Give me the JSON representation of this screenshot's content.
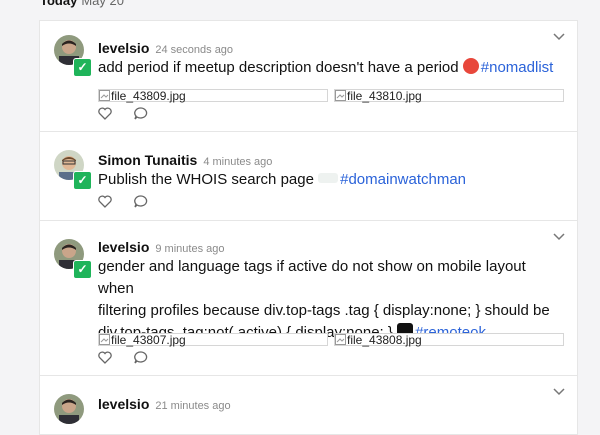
{
  "header": {
    "day_label": "Today",
    "date": "May 20"
  },
  "posts": [
    {
      "user": "levelsio",
      "time": "24 seconds ago",
      "text": "add period if meetup description doesn't have a period",
      "tag": "#nomadlist",
      "attachments": [
        "file_43809.jpg",
        "file_43810.jpg"
      ],
      "project_icon": "nomadlist-icon"
    },
    {
      "user": "Simon Tunaitis",
      "time": "4 minutes ago",
      "text": "Publish the WHOIS search page",
      "tag": "#domainwatchman",
      "attachments": [],
      "project_icon": "domainwatchman-icon"
    },
    {
      "user": "levelsio",
      "time": "9 minutes ago",
      "text_lines": [
        "gender and language tags if active do not show on mobile layout when",
        "filtering profiles because div.top-tags .tag { display:none; } should be",
        "div.top-tags .tag:not(.active) { display:none; }"
      ],
      "tag": "#remoteok",
      "attachments": [
        "file_43807.jpg",
        "file_43808.jpg"
      ],
      "project_icon": "remoteok-icon"
    },
    {
      "user": "levelsio",
      "time": "21 minutes ago"
    }
  ],
  "colors": {
    "accent_link": "#2b63d9",
    "check_green": "#1fb45a"
  }
}
